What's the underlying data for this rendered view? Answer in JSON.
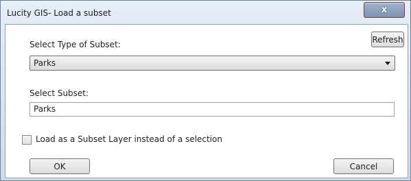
{
  "window": {
    "title": "Lucity GIS- Load a subset",
    "close_label": "x"
  },
  "form": {
    "type_label": "Select Type of Subset:",
    "refresh_label": "Refresh",
    "type_selected": "Parks",
    "subset_label": "Select Subset:",
    "subset_value": "Parks",
    "checkbox_label": "Load as a Subset Layer instead of a selection",
    "checkbox_checked": false
  },
  "buttons": {
    "ok_label": "OK",
    "cancel_label": "Cancel"
  }
}
